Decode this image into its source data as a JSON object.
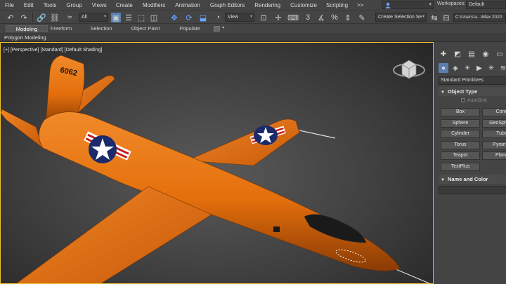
{
  "menu": {
    "items": [
      "File",
      "Edit",
      "Tools",
      "Group",
      "Views",
      "Create",
      "Modifiers",
      "Animation",
      "Graph Editors",
      "Rendering",
      "Customize",
      "Scripting"
    ],
    "more": ">>",
    "workspaces_label": "Workspaces:",
    "workspace_value": "Default"
  },
  "toolbar": {
    "filter_value": "All",
    "view_value": "View",
    "selection_set_value": "Create Selection Se",
    "path_value": "C:\\Users\\a...\\Max 2020"
  },
  "ribbon": {
    "tabs": [
      "Modeling",
      "Freeform",
      "Selection",
      "Object Paint",
      "Populate"
    ],
    "active_tab": "Modeling",
    "sub_label": "Polygon Modeling"
  },
  "viewport": {
    "label_plus": "[+]",
    "label_view": "[Perspective]",
    "label_mode": "[Standard]",
    "label_shading": "[Default Shading]",
    "tail_number": "6062",
    "colors": {
      "fuselage": "#e46f0c",
      "fuselage_shadow": "#8a3b05",
      "active_border": "#f0c030"
    }
  },
  "command_panel": {
    "category_value": "Standard Primitives",
    "object_type_header": "Object Type",
    "autogrid_label": "AutoGrid",
    "primitives": [
      "Box",
      "Cone",
      "Sphere",
      "GeoSphere",
      "Cylinder",
      "Tube",
      "Torus",
      "Pyramid",
      "Teapot",
      "Plane",
      "TextPlus"
    ],
    "name_color_header": "Name and Color"
  }
}
